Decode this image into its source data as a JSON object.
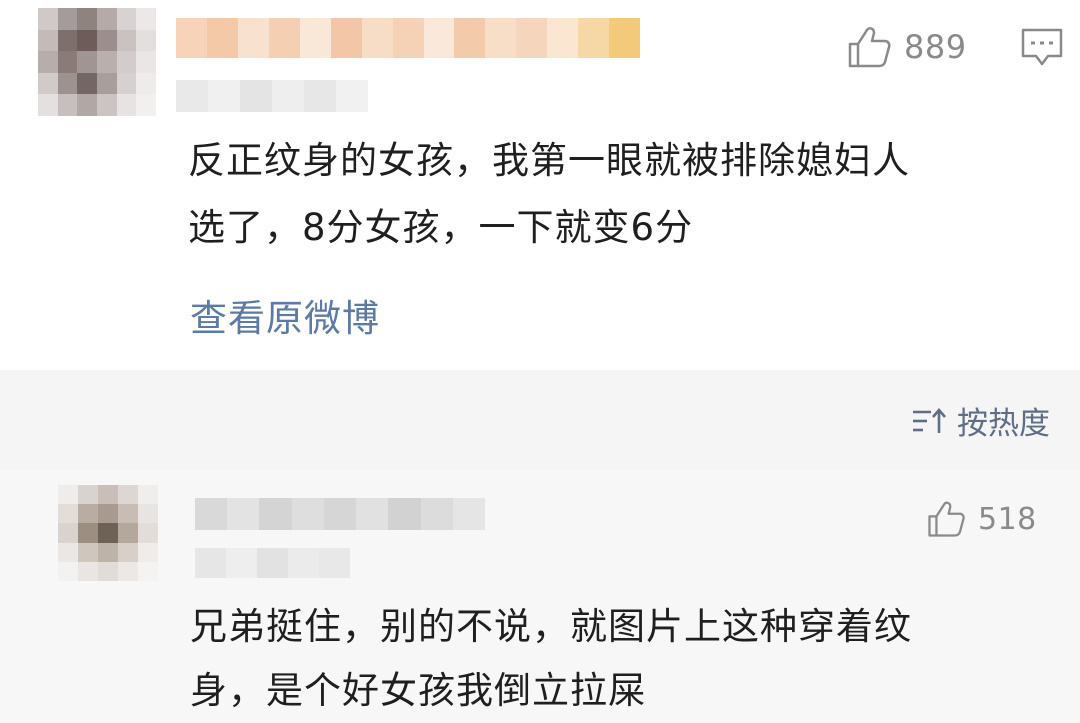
{
  "comments": [
    {
      "likes": "889",
      "text_lines": [
        "反正纹身的女孩，我第一眼就被排除媳妇人",
        "选了，8分女孩，一下就变6分"
      ],
      "view_original": "查看原微博"
    },
    {
      "likes": "518",
      "text_lines": [
        "兄弟挺住，别的不说，就图片上这种穿着纹",
        "身，是个好女孩我倒立拉屎"
      ]
    }
  ],
  "sort": {
    "label": "按热度"
  },
  "icons": {
    "like": "thumbs-up-icon",
    "reply": "comment-bubble-icon",
    "sort": "sort-order-icon"
  },
  "colors": {
    "link": "#5b7aa5",
    "sort_text": "#5d6e86",
    "icon_gray": "#8a8a8a",
    "sort_bar_bg": "#f5f5f5"
  }
}
